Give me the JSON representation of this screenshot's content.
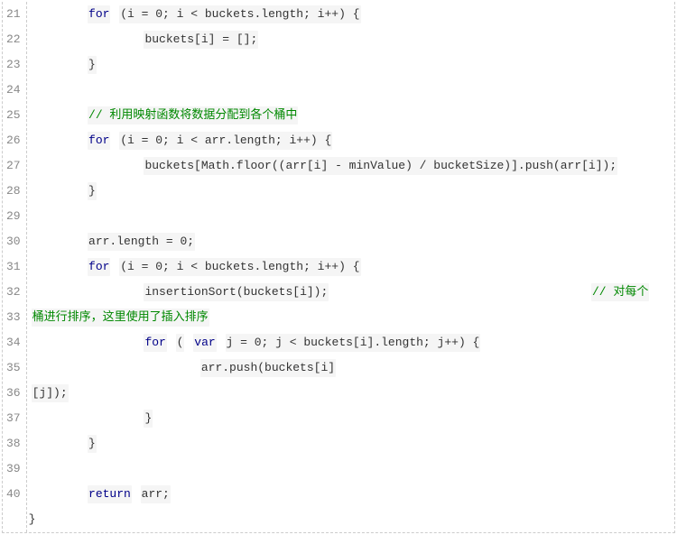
{
  "gutter": {
    "start": 21,
    "end": 40
  },
  "code": {
    "l21": {
      "for": "for",
      "expr": "(i = 0; i < buckets.length; i++) {"
    },
    "l22": {
      "stmt": "buckets[i] = [];"
    },
    "l23": {
      "close": "}"
    },
    "l25": {
      "comment": "// 利用映射函数将数据分配到各个桶中"
    },
    "l26": {
      "for": "for",
      "expr": "(i = 0; i < arr.length; i++) {"
    },
    "l27": {
      "stmt": "buckets[Math.floor((arr[i] - minValue) / bucketSize)].push(arr[i]);"
    },
    "l28": {
      "close": "}"
    },
    "l30": {
      "stmt": "arr.length = 0;"
    },
    "l31": {
      "for": "for",
      "expr": "(i = 0; i < buckets.length; i++) {"
    },
    "l32": {
      "stmt": "insertionSort(buckets[i]);",
      "tail": "// 对每个"
    },
    "l33": {
      "cont": "桶进行排序，这里使用了插入排序"
    },
    "l34": {
      "for": "for",
      "var": "var",
      "pre": "(",
      "mid": "j = 0; j < buckets[i].length; j++) {"
    },
    "l35": {
      "stmt": "arr.push(buckets[i]"
    },
    "l36": {
      "cont": "[j]);"
    },
    "l37": {
      "close": "}"
    },
    "l38": {
      "close": "}"
    },
    "l40": {
      "ret": "return",
      "val": "arr;"
    },
    "lend": {
      "close": "}"
    }
  }
}
